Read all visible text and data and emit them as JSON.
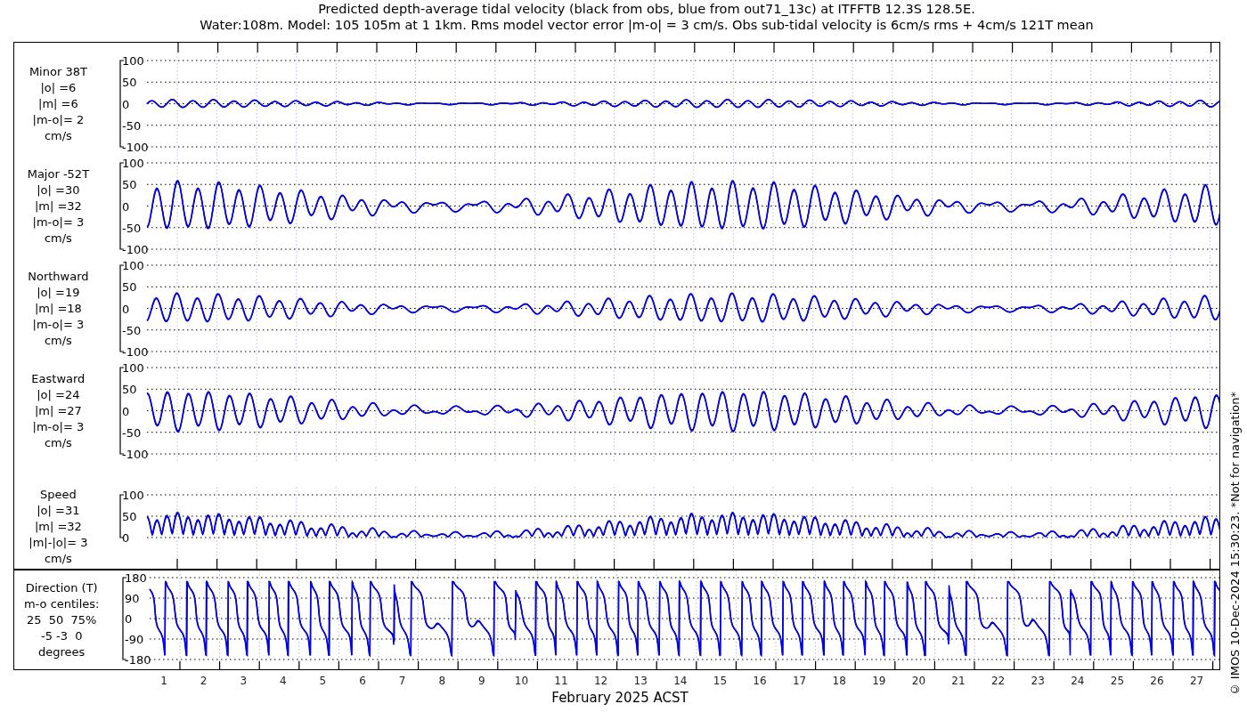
{
  "title": [
    "Predicted depth-average tidal velocity (black from obs, blue from out71_13c) at ITFFTB 12.3S 128.5E.",
    "Water:108m. Model: 105 105m at 1 1km. Rms model vector error |m-o| = 3 cm/s. Obs sub-tidal velocity is 6cm/s rms + 4cm/s 121T mean"
  ],
  "panels": [
    {
      "kind": "minor",
      "label": [
        "Minor 38T",
        "|o| =6",
        "|m| =6",
        "|m-o|= 2",
        "cm/s"
      ],
      "y_ticks": [
        "100",
        "50",
        "0",
        "-50",
        "-100"
      ]
    },
    {
      "kind": "major",
      "label": [
        "Major -52T",
        "|o| =30",
        "|m| =32",
        "|m-o|= 3",
        "cm/s"
      ],
      "y_ticks": [
        "100",
        "50",
        "0",
        "-50",
        "-100"
      ]
    },
    {
      "kind": "northward",
      "label": [
        "Northward",
        "|o| =19",
        "|m| =18",
        "|m-o|= 3",
        "cm/s"
      ],
      "y_ticks": [
        "100",
        "50",
        "0",
        "-50",
        "-100"
      ]
    },
    {
      "kind": "eastward",
      "label": [
        "Eastward",
        "|o| =24",
        "|m| =27",
        "|m-o|= 3",
        "cm/s"
      ],
      "y_ticks": [
        "100",
        "50",
        "0",
        "-50",
        "-100"
      ]
    },
    {
      "kind": "speed",
      "label": [
        "Speed",
        "|o| =31",
        "|m| =32",
        "|m|-|o|= 3",
        "cm/s"
      ],
      "y_ticks": [
        "100",
        "50",
        "0"
      ]
    },
    {
      "kind": "direction",
      "label": [
        "Direction (T)",
        "m-o centiles:",
        "25  50  75%",
        "-5 -3  0",
        "degrees"
      ],
      "y_ticks": [
        "180",
        "90",
        "0",
        "-90",
        "-180"
      ]
    }
  ],
  "x_ticks": [
    "1",
    "2",
    "3",
    "4",
    "5",
    "6",
    "7",
    "8",
    "9",
    "10",
    "11",
    "12",
    "13",
    "14",
    "15",
    "16",
    "17",
    "18",
    "19",
    "20",
    "21",
    "22",
    "23",
    "24",
    "25",
    "26",
    "27"
  ],
  "xlabel": "February 2025 ACST",
  "footer": "© IMOS 10-Dec-2024 15:30:23. *Not for navigation*"
}
